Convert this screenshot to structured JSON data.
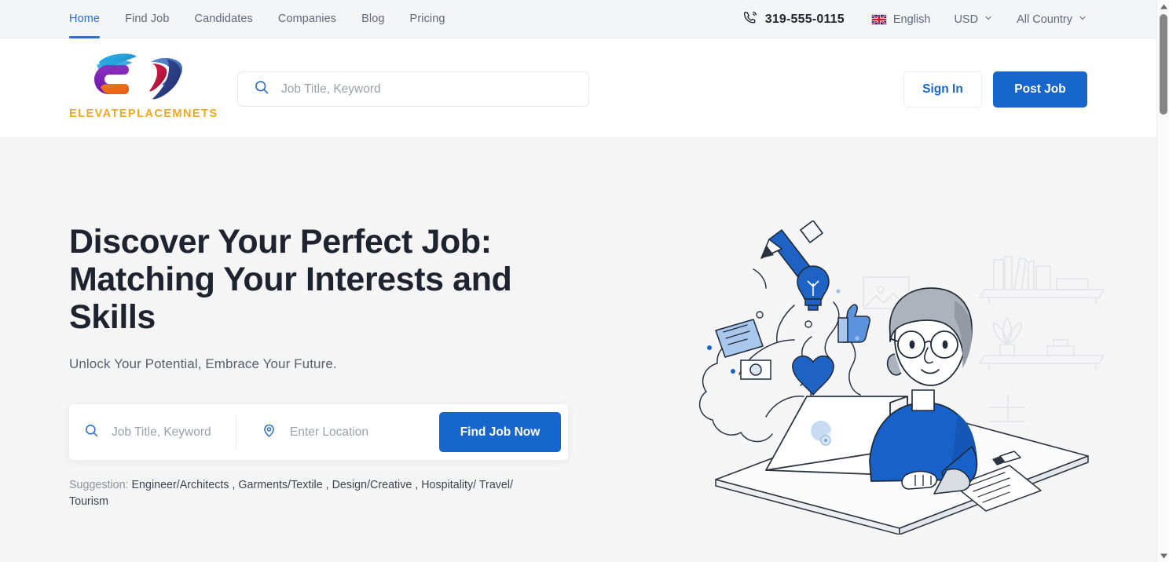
{
  "topbar": {
    "nav": [
      {
        "label": "Home",
        "active": true
      },
      {
        "label": "Find Job",
        "active": false
      },
      {
        "label": "Candidates",
        "active": false
      },
      {
        "label": "Companies",
        "active": false
      },
      {
        "label": "Blog",
        "active": false
      },
      {
        "label": "Pricing",
        "active": false
      }
    ],
    "phone": "319-555-0115",
    "phone_icon": "phone-ring-icon",
    "language": {
      "label": "English",
      "flag": "uk-flag-icon"
    },
    "currency": {
      "label": "USD",
      "icon": "chevron-down-icon"
    },
    "country": {
      "label": "All Country",
      "icon": "chevron-down-icon"
    }
  },
  "header": {
    "logo_text": "ELEVATEPLACEMNETS",
    "logo_icon": "elevate-placements-logo",
    "search": {
      "placeholder": "Job Title, Keyword",
      "icon": "search-icon"
    },
    "sign_in_label": "Sign In",
    "post_job_label": "Post Job"
  },
  "hero": {
    "heading": "Discover Your Perfect Job: Matching Your Interests and Skills",
    "subheading": "Unlock Your Potential, Embrace Your Future.",
    "search": {
      "keyword_placeholder": "Job Title, Keyword",
      "keyword_icon": "search-icon",
      "location_placeholder": "Enter Location",
      "location_icon": "map-pin-icon",
      "button_label": "Find Job Now"
    },
    "suggestion_label": "Suggestion:",
    "suggestions": [
      "Engineer/Architects",
      "Garments/Textile",
      "Design/Creative",
      "Hospitality/ Travel/ Tourism"
    ],
    "separator": " , ",
    "illustration": "person-at-laptop-illustration"
  },
  "colors": {
    "accent_blue": "#1766cc",
    "nav_active": "#2b6fcf",
    "logo_orange": "#f0a81e",
    "page_bg": "#f5f5f6",
    "topbar_bg": "#f4f5f6"
  },
  "scrollbar": {
    "up_icon": "scroll-up-arrow-icon",
    "down_icon": "scroll-down-arrow-icon"
  }
}
